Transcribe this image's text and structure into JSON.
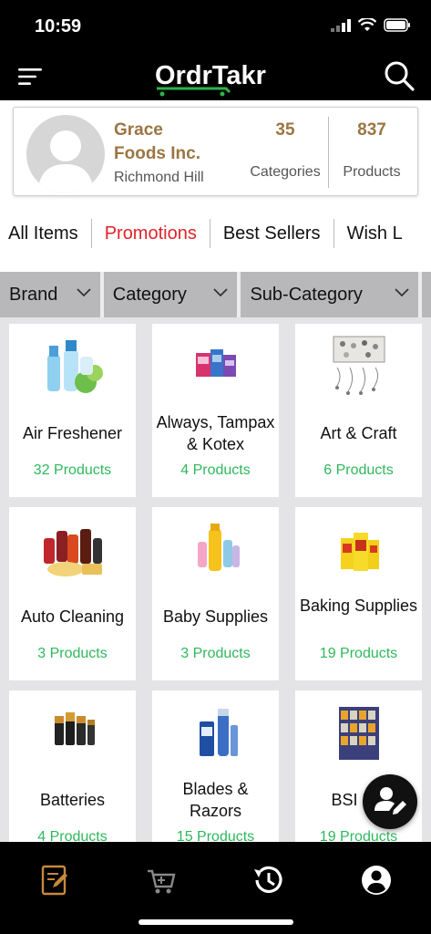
{
  "status_bar": {
    "time": "10:59"
  },
  "header": {
    "logo_text": "OrdrTakr"
  },
  "supplier": {
    "name": "Grace Foods Inc.",
    "city": "Richmond Hill",
    "categories_count": "35",
    "categories_label": "Categories",
    "products_count": "837",
    "products_label": "Products"
  },
  "tabs": [
    {
      "label": "All Items",
      "active": false
    },
    {
      "label": "Promotions",
      "active": true
    },
    {
      "label": "Best Sellers",
      "active": false
    },
    {
      "label": "Wish L",
      "active": false
    }
  ],
  "filters": [
    {
      "label": "Brand"
    },
    {
      "label": "Category"
    },
    {
      "label": "Sub-Category"
    }
  ],
  "categories": [
    {
      "name": "Air Freshener",
      "count": "32 Products",
      "icon": "air-freshener-image"
    },
    {
      "name": "Always, Tampax & Kotex",
      "count": "4 Products",
      "icon": "feminine-care-image"
    },
    {
      "name": "Art & Craft",
      "count": "6 Products",
      "icon": "art-craft-image"
    },
    {
      "name": "Auto Cleaning",
      "count": "3 Products",
      "icon": "auto-cleaning-image"
    },
    {
      "name": "Baby Supplies",
      "count": "3 Products",
      "icon": "baby-supplies-image"
    },
    {
      "name": "Baking Supplies",
      "count": "19 Products",
      "icon": "baking-supplies-image"
    },
    {
      "name": "Batteries",
      "count": "4 Products",
      "icon": "batteries-image"
    },
    {
      "name": "Blades & Razors",
      "count": "15 Products",
      "icon": "razors-image"
    },
    {
      "name": "BSI Dis",
      "count": "19 Products",
      "icon": "bsi-display-image"
    }
  ],
  "colors": {
    "accent_gold": "#9b7543",
    "promo_red": "#e2232a",
    "count_green": "#2eb85c",
    "logo_green": "#2db34a"
  },
  "bottom_nav": [
    {
      "icon": "order-pad-icon",
      "active": true
    },
    {
      "icon": "cart-icon",
      "active": false
    },
    {
      "icon": "history-icon",
      "active": false
    },
    {
      "icon": "account-icon",
      "active": false
    }
  ]
}
